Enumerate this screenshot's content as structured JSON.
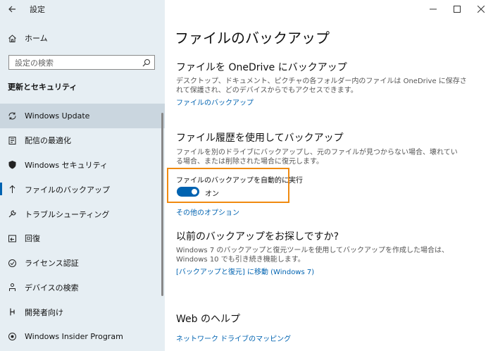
{
  "window": {
    "title": "設定"
  },
  "sidebar": {
    "home_label": "ホーム",
    "search_placeholder": "設定の検索",
    "section_title": "更新とセキュリティ",
    "items": [
      {
        "label": "Windows Update",
        "icon": "sync-icon"
      },
      {
        "label": "配信の最適化",
        "icon": "delivery-optimization-icon"
      },
      {
        "label": "Windows セキュリティ",
        "icon": "shield-icon"
      },
      {
        "label": "ファイルのバックアップ",
        "icon": "backup-arrow-icon"
      },
      {
        "label": "トラブルシューティング",
        "icon": "wrench-icon"
      },
      {
        "label": "回復",
        "icon": "recovery-icon"
      },
      {
        "label": "ライセンス認証",
        "icon": "check-circle-icon"
      },
      {
        "label": "デバイスの検索",
        "icon": "person-location-icon"
      },
      {
        "label": "開発者向け",
        "icon": "developer-icon"
      },
      {
        "label": "Windows Insider Program",
        "icon": "insider-icon"
      }
    ]
  },
  "main": {
    "page_title": "ファイルのバックアップ",
    "onedrive": {
      "heading": "ファイルを OneDrive にバックアップ",
      "desc_line1": "デスクトップ、ドキュメント、ピクチャの各フォルダー内のファイルは OneDrive に保存さ",
      "desc_line2": "れて保護され、どのデバイスからでもアクセスできます。",
      "link": "ファイルのバックアップ"
    },
    "history": {
      "heading": "ファイル履歴を使用してバックアップ",
      "desc_line1": "ファイルを別のドライブにバックアップし、元のファイルが見つからない場合、壊れてい",
      "desc_line2": "る場合、または削除された場合に復元します。",
      "toggle_label": "ファイルのバックアップを自動的に実行",
      "toggle_state": "オン",
      "more_options": "その他のオプション"
    },
    "previous": {
      "heading": "以前のバックアップをお探しですか?",
      "desc_line1": "Windows 7 のバックアップと復元ツールを使用してバックアップを作成した場合は、",
      "desc_line2": "Windows 10 でも引き続き機能します。",
      "link": "[バックアップと復元] に移動 (Windows 7)"
    },
    "help": {
      "heading": "Web のヘルプ",
      "link": "ネットワーク ドライブのマッピング"
    }
  },
  "colors": {
    "accent": "#0063b1",
    "highlight": "#f08a10",
    "sidebar_bg": "#e6eef3"
  }
}
